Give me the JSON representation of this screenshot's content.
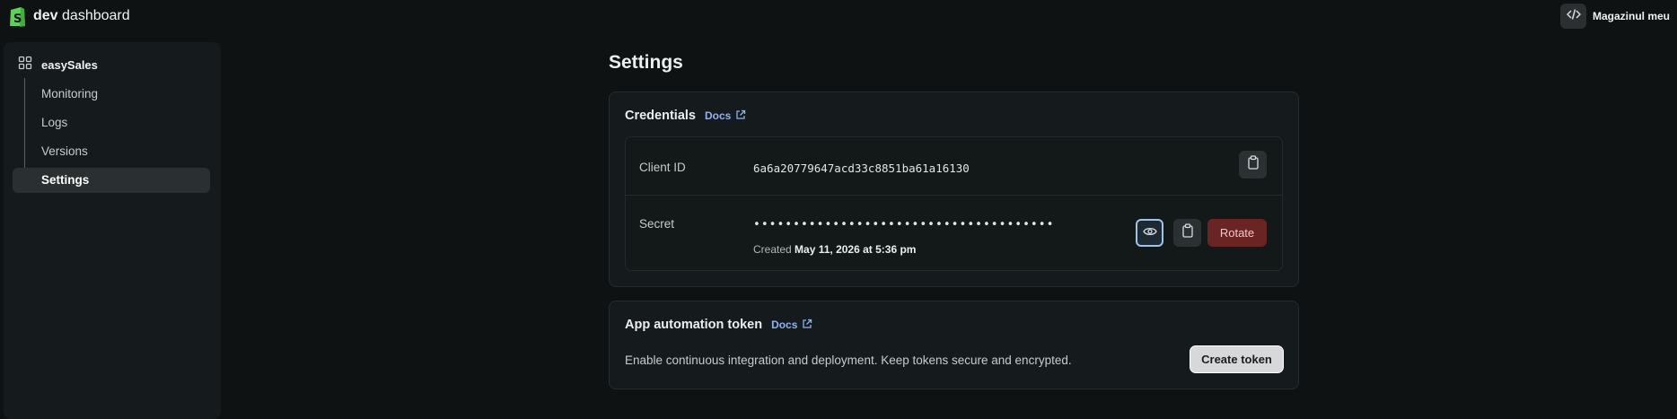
{
  "topbar": {
    "brand_bold": "dev",
    "brand_rest": "dashboard",
    "store_name": "Magazinul meu"
  },
  "sidebar": {
    "app_name": "easySales",
    "items": [
      {
        "label": "Monitoring"
      },
      {
        "label": "Logs"
      },
      {
        "label": "Versions"
      },
      {
        "label": "Settings",
        "active": true
      }
    ]
  },
  "main": {
    "title": "Settings",
    "credentials": {
      "title": "Credentials",
      "docs_label": "Docs",
      "client_id_label": "Client ID",
      "client_id_value": "6a6a20779647acd33c8851ba61a16130",
      "secret_label": "Secret",
      "secret_value": "••••••••••••••••••••••••••••••••••••••",
      "created_prefix": "Created",
      "created_date": "May 11, 2026 at 5:36 pm",
      "rotate_label": "Rotate"
    },
    "automation": {
      "title": "App automation token",
      "docs_label": "Docs",
      "description": "Enable continuous integration and deployment. Keep tokens secure and encrypted.",
      "create_label": "Create token"
    }
  },
  "colors": {
    "accent_link": "#8fb2f5",
    "danger": "#6b2424",
    "brand_green": "#5fd15b"
  }
}
